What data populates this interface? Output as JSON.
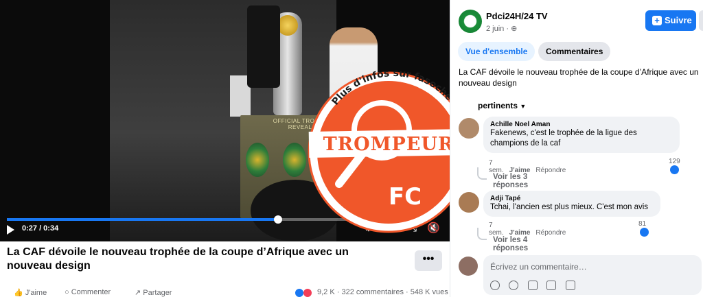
{
  "video": {
    "scene_text": "OFFICIAL TROPHY REVEAL",
    "stamp": {
      "verdict": "TROMPEUR",
      "tagline": "Plus d'infos sur fasocheck.org",
      "logo_text": "FC"
    },
    "time": "0:27 / 0:34",
    "progress": 0.79,
    "title": "La CAF dévoile le nouveau trophée de la coupe d’Afrique avec un nouveau design",
    "more_label": "•••"
  },
  "actions": {
    "like": "J'aime",
    "comment": "Commenter",
    "share": "Partager",
    "stats": "9,2 K · 322 commentaires · 548 K vues"
  },
  "panel": {
    "page_name": "Pdci24H/24 TV",
    "date": "2 juin · ",
    "follow_label": "Suivre",
    "tabs": {
      "overview": "Vue d'ensemble",
      "comments": "Commentaires"
    },
    "post_text": "La CAF dévoile le nouveau trophée de la coupe d’Afrique avec un nouveau design",
    "sort_label": "pertinents",
    "comments": [
      {
        "name": "Achille Noel Aman",
        "text": "Fakenews, c'est le trophée de la ligue des champions de la caf",
        "age": "7 sem.",
        "like": "J'aime",
        "reply": "Répondre",
        "likes": "129",
        "replies": "Voir les 3 réponses"
      },
      {
        "name": "Adji Tapé",
        "text": "Tchai, l'ancien est plus mieux. C'est mon avis",
        "age": "7 sem.",
        "like": "J'aime",
        "reply": "Répondre",
        "likes": "81",
        "replies": "Voir les 4 réponses"
      }
    ],
    "composer_placeholder": "Écrivez un commentaire…"
  },
  "colors": {
    "accent": "#1877f2",
    "stamp": "#f0572a"
  }
}
